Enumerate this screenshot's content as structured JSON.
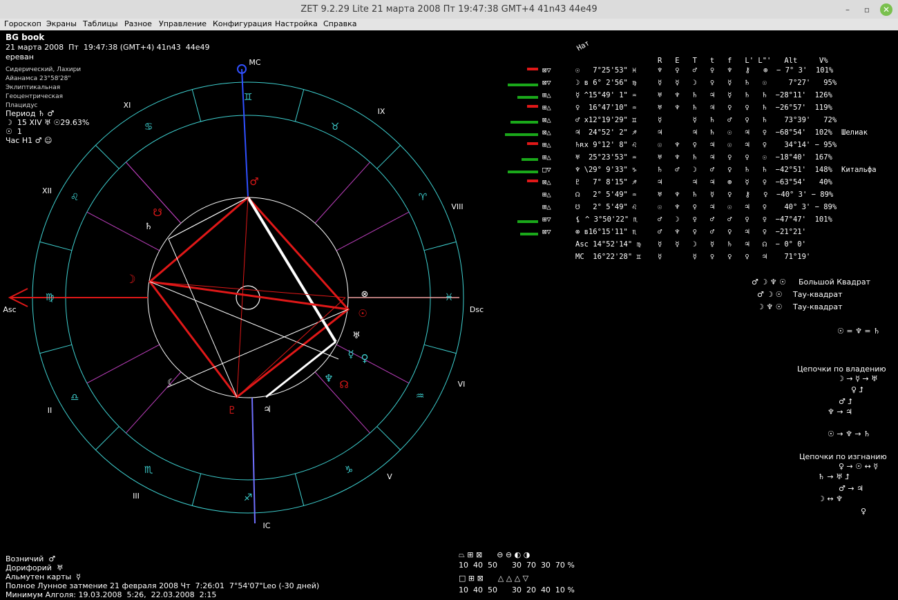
{
  "window": {
    "title": "ZET 9.2.29 Lite   21 марта 2008  Пт  19:47:38 GMT+4 41n43  44e49",
    "controls": [
      "–",
      "▫",
      "✕"
    ]
  },
  "menu": [
    "Гороскоп",
    "Экраны",
    "Таблицы",
    "Разное",
    "Управление",
    "Конфигурация",
    "Настройка",
    "Справка"
  ],
  "header": {
    "name": "BG book",
    "datetime": "21 марта 2008  Пт  19:47:38 (GMT+4) 41n43  44e49",
    "place": "ереван",
    "info": [
      "Сидерический, Лахири",
      "Айанамса 23°58'28\"",
      "Эклиптикальная",
      "Геоцентрическая",
      "Плацидус"
    ],
    "period_label": "Период ♄ ♂",
    "period_line2": "☽  15 XIV ♅ ☉29.63%",
    "period_line3": "☉  1",
    "hour": "Час H1 ♂ ☺"
  },
  "houses": {
    "MC": "MC",
    "IC": "IC",
    "Asc": "Asc",
    "Dsc": "Dsc",
    "roman": [
      "XI",
      "IX",
      "XII",
      "VIII",
      "II",
      "VI",
      "III",
      "V"
    ]
  },
  "table": {
    "header": "R   E   T   t   f   L' L\"'   Alt     V%",
    "nat": "Нат",
    "rows": [
      {
        "p": "☉   7°25'53\" ♓",
        "rest": "♆   ♀   ♂   ♀   ♆   ⚷   ⊕  − 7° 3'  101%",
        "bar": "red",
        "aspect": "⊠▽"
      },
      {
        "p": "☽ в 6° 2'56\" ♍",
        "rest": "☿   ☿   ☽   ♀   ☿   ♄   ☉     7°27'   95%",
        "bar": "green",
        "aspect": "⊠▽"
      },
      {
        "p": "☿ ^15°49' 1\" ♒",
        "rest": "♅   ♆   ♄   ♃   ☿   ♄   ♄  −28°11'  126%",
        "bar": "green",
        "aspect": "⊞△"
      },
      {
        "p": "♀  16°47'10\" ♒",
        "rest": "♅   ♆   ♄   ♃   ♀   ♀   ♄  −26°57'  119%",
        "bar": "red",
        "aspect": "⊞△"
      },
      {
        "p": "♂ x12°19'29\" ♊",
        "rest": "☿       ☿   ♄   ♂   ♀   ♄    73°39'   72%",
        "bar": "green",
        "aspect": "⊠△"
      },
      {
        "p": "♃  24°52' 2\" ♐",
        "rest": "♃       ♃   ♄   ☉   ♃   ♀  −68°54'  102%",
        "bar": "green",
        "aspect": "⊠△",
        "star": "Шелиак"
      },
      {
        "p": "♄ʀx 9°12' 8\" ♌",
        "rest": "☉   ♆   ♀   ♃   ☉   ♃   ♀    34°14' − 95%",
        "bar": "red",
        "aspect": "⊞△"
      },
      {
        "p": "♅  25°23'53\" ♒",
        "rest": "♅   ♆   ♄   ♃   ♀   ♀   ☉  −18°40'  167%",
        "bar": "green",
        "aspect": "⊞△"
      },
      {
        "p": "♆ \\29° 9'33\" ♑",
        "rest": "♄   ♂   ☽   ♂   ♀   ♄   ♄  −42°51'  148%",
        "bar": "green",
        "aspect": "□▽",
        "star": "Китальфа"
      },
      {
        "p": "♇   7° 8'15\" ♐",
        "rest": "♃       ♃   ♃   ⊕   ☿   ♀  −63°54'   40%",
        "bar": "red",
        "aspect": "⊠△"
      },
      {
        "p": "☊   2° 5'49\" ♒",
        "rest": "♅   ♆   ♄   ☿   ♀   ⚷   ♀  −40° 3' − 89%",
        "bar": "",
        "aspect": "⊞△"
      },
      {
        "p": "☋   2° 5'49\" ♌",
        "rest": "☉   ♆   ♀   ♃   ☉   ♃   ♀    40° 3' − 89%",
        "bar": "",
        "aspect": "⊞△"
      },
      {
        "p": "⚸ ^ 3°50'22\" ♏",
        "rest": "♂   ☽   ♀   ♂   ♂   ♀   ♀  −47°47'  101%",
        "bar": "green",
        "aspect": "⊞▽"
      },
      {
        "p": "⊗ в16°15'11\" ♏",
        "rest": "♂   ♆   ♀   ♂   ♀   ♃   ♀  −21°21'",
        "bar": "green",
        "aspect": "⊠▽"
      },
      {
        "p": "Asc 14°52'14\" ♍",
        "rest": "☿   ☿   ☽   ☿   ♄   ♃   ☊  − 0° 0'",
        "bar": "",
        "aspect": ""
      },
      {
        "p": "MC  16°22'28\" ♊",
        "rest": "☿       ☿   ♀   ♀   ♀   ♃    71°19'",
        "bar": "",
        "aspect": ""
      }
    ]
  },
  "configs": [
    {
      "sym": "♂ ☽ ♆ ☉",
      "label": "Большой Квадрат"
    },
    {
      "sym": "♂ ☽ ☉",
      "label": "Тау-квадрат"
    },
    {
      "sym": "☽ ♆ ☉",
      "label": "Тау-квадрат"
    }
  ],
  "equation": "☉ = ♆ = ♄",
  "chains_possession": {
    "title": "Цепочки по владению",
    "lines": [
      "☽ → ☿ → ♅",
      "♀ ⮥",
      "♂ ⮥",
      "♆ → ♃",
      "☉ → ♆ → ♄"
    ]
  },
  "chains_exile": {
    "title": "Цепочки по изгнанию",
    "lines": [
      "♀ → ☉ ↔ ☿",
      "♄ → ♅ ⮥",
      "♂ → ♃",
      "☽ ↔ ♆",
      "♀"
    ]
  },
  "footer": {
    "l1": "Возничий  ♂",
    "l2": "Дорифорий  ♅",
    "l3": "Альмутен карты  ☿",
    "l4": "Полное Лунное затмение 21 февраля 2008 Чт  7:26:01  7°54'07\"Leo (-30 дней)",
    "l5": "Минимум Алголя: 19.03.2008  5:26,  22.03.2008  2:15"
  },
  "stats": {
    "r1_sym": "⏢ ⊞ ⊠      ⊖ ⊖ ◐ ◑",
    "r1_val": "10  40  50      30  70  30  70 %",
    "r2_sym": "□ ⊞ ⊠      △ △ △ ▽",
    "r2_val": "10  40  50      30  20  40  10 %"
  },
  "colors": {
    "cyan": "#3fd3d3",
    "red": "#e01818",
    "blue": "#3050ff",
    "magenta": "#c040c0",
    "green": "#1aa81a"
  }
}
